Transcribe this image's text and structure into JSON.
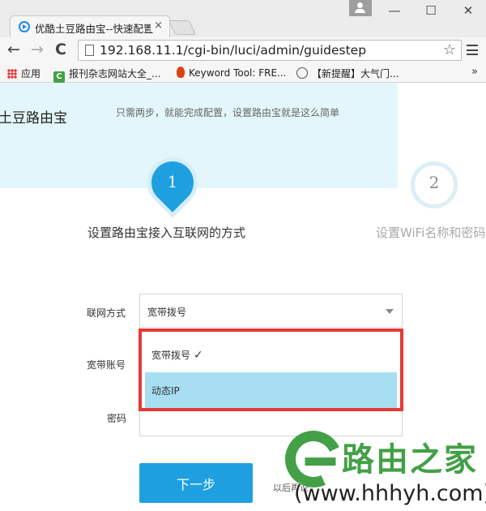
{
  "browser": {
    "tab_title": "优酷土豆路由宝--快速配置",
    "tab_close": "×",
    "window_minimize": "—",
    "window_maximize": "☐",
    "window_close": "✕",
    "nav_back": "←",
    "nav_forward": "→",
    "nav_reload": "C",
    "url": "192.168.11.1/cgi-bin/luci/admin/guidestep",
    "star": "☆"
  },
  "bookmarks": {
    "apps": "应用",
    "items": [
      "报刊杂志网站大全_...",
      "Keyword Tool: FRE...",
      "【新提醒】大气门..."
    ],
    "more": "»"
  },
  "page": {
    "brand": "土豆路由宝",
    "tagline": "只需两步，就能完成配置，设置路由宝就是这么简单",
    "steps": [
      {
        "number": "1",
        "title": "设置路由宝接入互联网的方式",
        "active": true
      },
      {
        "number": "2",
        "title": "设置WiFi名称和密码",
        "active": false
      }
    ],
    "form": {
      "connection_label": "联网方式",
      "connection_value": "宽带拨号",
      "account_label": "宽带账号",
      "password_label": "密码",
      "options": [
        "宽带拨号",
        "动态IP"
      ],
      "selected_index": 0,
      "highlighted_index": 1
    },
    "next_button": "下一步",
    "later_link": "以后再说"
  },
  "watermark": {
    "brand": "路由之家",
    "url": "(www.hhhyh.com)"
  },
  "colors": {
    "accent": "#1ea0e0",
    "hero_bg": "#e3f6fb",
    "highlight_border": "#e53935",
    "option_hover": "#a8def2",
    "watermark_green": "#43a047"
  }
}
